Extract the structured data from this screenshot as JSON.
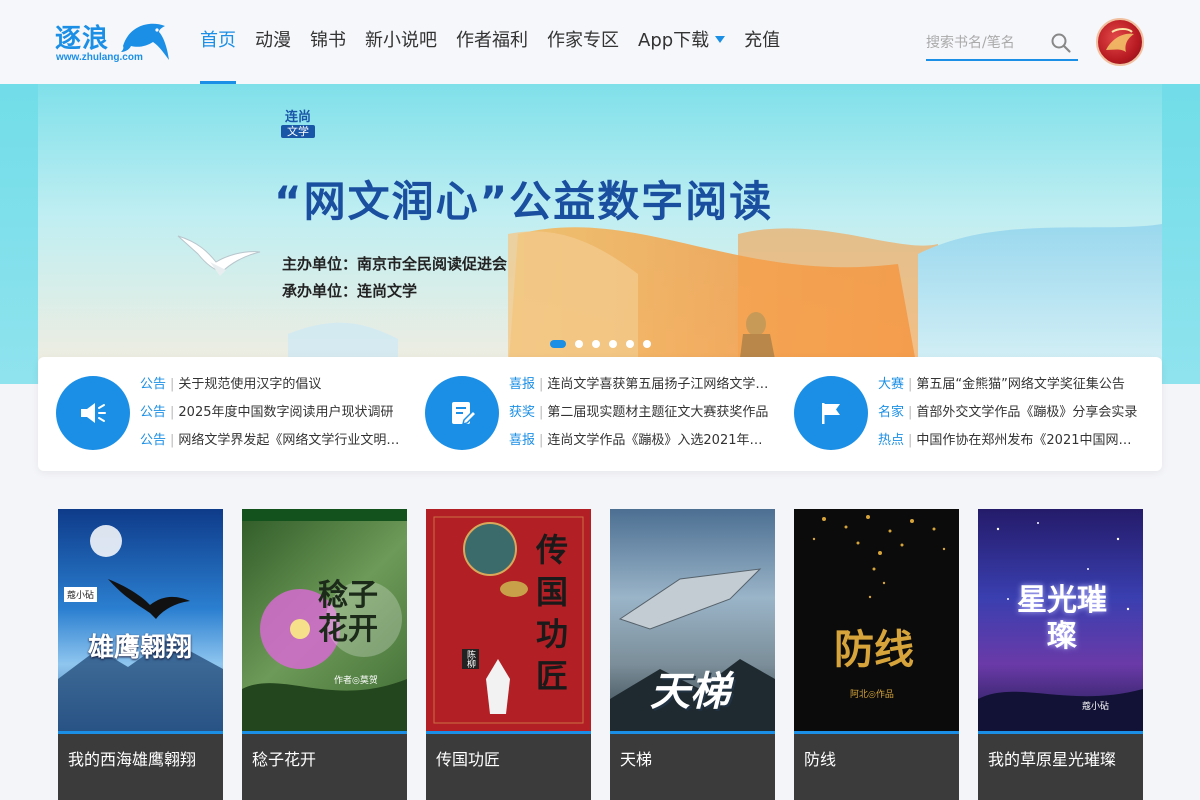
{
  "header": {
    "logo_text": "逐浪",
    "logo_url": "www.zhulang.com",
    "nav": [
      {
        "label": "首页",
        "active": true
      },
      {
        "label": "动漫"
      },
      {
        "label": "锦书"
      },
      {
        "label": "新小说吧"
      },
      {
        "label": "作者福利"
      },
      {
        "label": "作家专区"
      },
      {
        "label": "App下载",
        "dropdown": true
      },
      {
        "label": "充值"
      }
    ],
    "search_placeholder": "搜索书名/笔名"
  },
  "banner": {
    "brand_top": "连尚",
    "brand_bottom": "文学",
    "title": "“网文润心”公益数字阅读",
    "line1": "主办单位：南京市全民阅读促进会",
    "line2": "承办单位：连尚文学",
    "slide_count": 6,
    "active_slide": 0
  },
  "notices": [
    {
      "icon": "megaphone-icon",
      "items": [
        {
          "tag": "公告",
          "text": "关于规范使用汉字的倡议"
        },
        {
          "tag": "公告",
          "text": "2025年度中国数字阅读用户现状调研"
        },
        {
          "tag": "公告",
          "text": "网络文学界发起《网络文学行业文明…"
        }
      ]
    },
    {
      "icon": "edit-document-icon",
      "items": [
        {
          "tag": "喜报",
          "text": "连尚文学喜获第五届扬子江网络文学…"
        },
        {
          "tag": "获奖",
          "text": "第二届现实题材主题征文大赛获奖作品"
        },
        {
          "tag": "喜报",
          "text": "连尚文学作品《蹦极》入选2021年度…"
        }
      ]
    },
    {
      "icon": "flag-icon",
      "items": [
        {
          "tag": "大赛",
          "text": "第五届“金熊猫”网络文学奖征集公告"
        },
        {
          "tag": "名家",
          "text": "首部外交文学作品《蹦极》分享会实录"
        },
        {
          "tag": "热点",
          "text": "中国作协在郑州发布《2021中国网络…"
        }
      ]
    }
  ],
  "books": [
    {
      "name": "我的西海雄鹰翱翔",
      "cover_text": "雄鹰翱翔",
      "author_badge": "蔻小砧"
    },
    {
      "name": "稔子花开",
      "cover_text": "稔子花开",
      "author_badge": "作者◎莫贺"
    },
    {
      "name": "传国功匠",
      "cover_text": "传国功匠",
      "author_badge": "陈柳"
    },
    {
      "name": "天梯",
      "cover_text": "天梯",
      "author_badge": ""
    },
    {
      "name": "防线",
      "cover_text": "防线",
      "author_badge": "阿北◎作品"
    },
    {
      "name": "我的草原星光璀璨",
      "cover_text": "星光璀璨",
      "author_badge": "蔻小砧"
    }
  ],
  "colors": {
    "accent": "#1b8fe6",
    "book_label_bg": "#3b3b3b",
    "page_bg": "#f4f5f9"
  }
}
